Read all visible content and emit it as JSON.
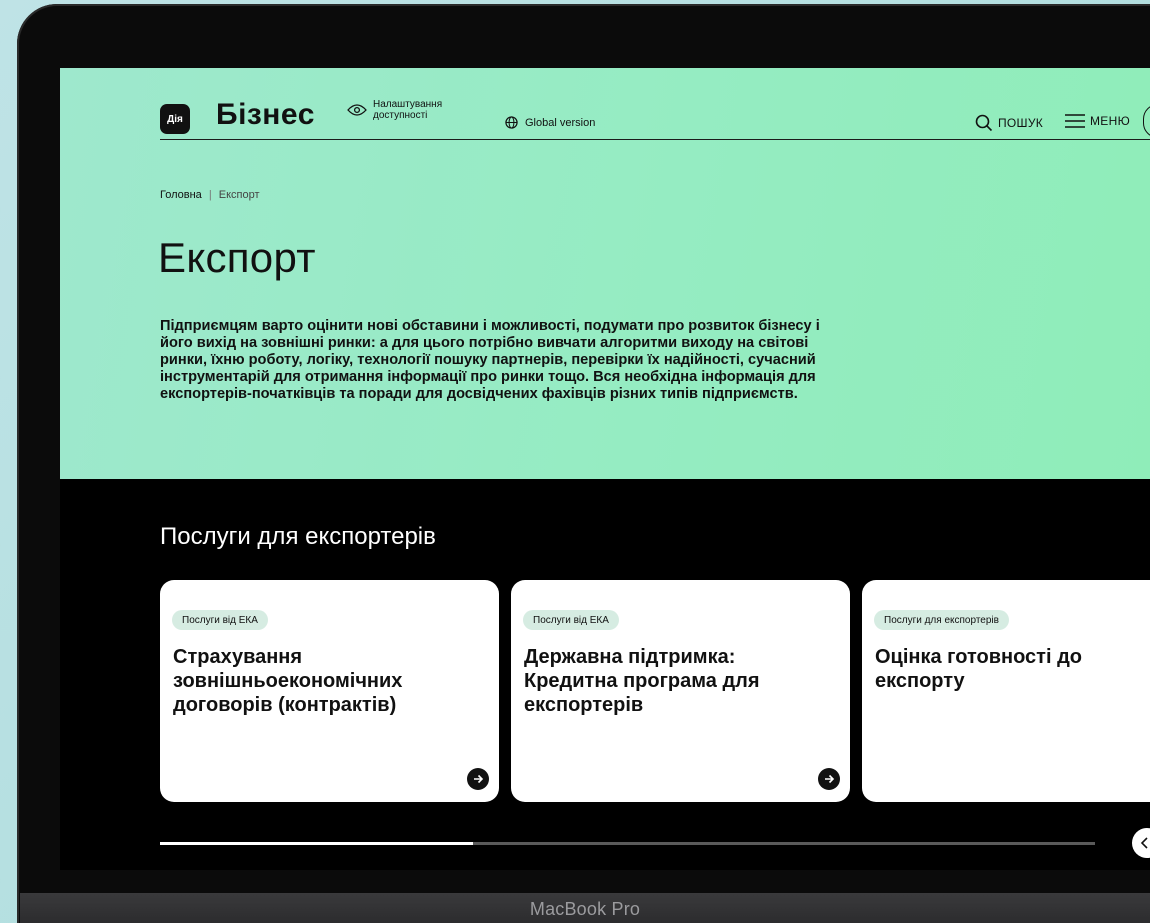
{
  "device": {
    "label": "MacBook Pro"
  },
  "header": {
    "logo_text": "Дія",
    "brand": "Бізнес",
    "accessibility_label": "Налаштування доступності",
    "global_label": "Global version",
    "search_label": "ПОШУК",
    "menu_label": "МЕНЮ"
  },
  "breadcrumb": {
    "home": "Головна",
    "separator": "|",
    "current": "Експорт"
  },
  "page": {
    "title": "Експорт",
    "intro": "Підприємцям варто оцінити нові обставини і можливості, подумати про розвиток бізнесу і його вихід на зовнішні ринки: а для цього потрібно вивчати алгоритми виходу на світові ринки, їхню роботу, логіку, технології пошуку партнерів, перевірки їх надійності, сучасний інструментарій для отримання інформації про ринки тощо. Вся необхідна інформація для експортерів-початківців та поради для досвідчених фахівців різних типів підприємств."
  },
  "services": {
    "title": "Послуги для експортерів",
    "cards": [
      {
        "tag": "Послуги від ЕКА",
        "title": "Страхування зовнішньоекономічних договорів (контрактів)"
      },
      {
        "tag": "Послуги від ЕКА",
        "title": "Державна підтримка: Кредитна програма для експортерів"
      },
      {
        "tag": "Послуги для експортерів",
        "title": "Оцінка готовності до експорту"
      }
    ],
    "carousel_progress": 0.335
  },
  "colors": {
    "hero_bg": "#95ecc2",
    "dark_bg": "#000000",
    "tag_bg": "#d6ece2"
  }
}
